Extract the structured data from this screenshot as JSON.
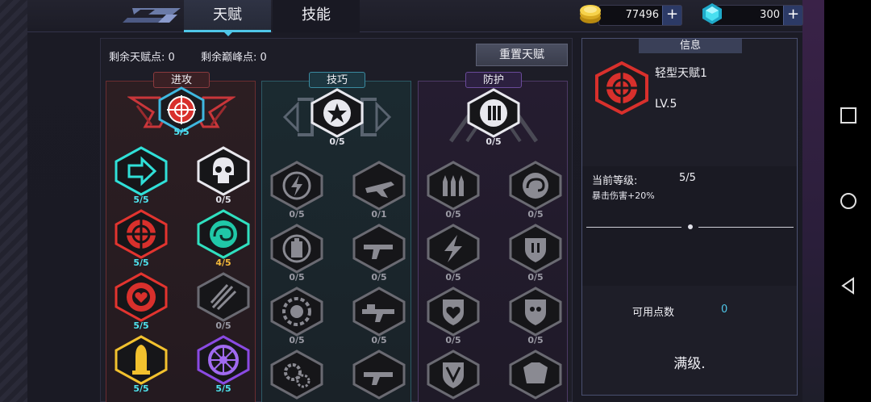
{
  "tabs": {
    "talent": "天赋",
    "skill": "技能"
  },
  "currency": {
    "gold": "77496",
    "gems": "300",
    "plus": "+"
  },
  "points": {
    "talent_label": "剩余天赋点: 0",
    "peak_label": "剩余巅峰点: 0"
  },
  "reset_button": "重置天赋",
  "columns": {
    "attack": {
      "title": "进攻",
      "nodes": [
        {
          "icon": "crosshair-icon",
          "level": "5/5"
        },
        {
          "icon": "arrow-icon",
          "level": "5/5"
        },
        {
          "icon": "skull-icon",
          "level": "0/5"
        },
        {
          "icon": "target-icon",
          "level": "5/5"
        },
        {
          "icon": "swirl-icon",
          "level": "4/5"
        },
        {
          "icon": "heart-gear-icon",
          "level": "5/5"
        },
        {
          "icon": "slash-icon",
          "level": "0/5"
        },
        {
          "icon": "bullet-icon",
          "level": "5/5"
        },
        {
          "icon": "wheel-icon",
          "level": "5/5"
        }
      ]
    },
    "skill": {
      "title": "技巧",
      "nodes": [
        {
          "icon": "star-icon",
          "level": "0/5"
        },
        {
          "icon": "lightning-icon",
          "level": "0/5"
        },
        {
          "icon": "jet-icon",
          "level": "0/1"
        },
        {
          "icon": "battery-icon",
          "level": "0/5"
        },
        {
          "icon": "gun-icon",
          "level": "0/5"
        },
        {
          "icon": "gear-icon",
          "level": "0/5"
        },
        {
          "icon": "rifle-icon",
          "level": "0/5"
        },
        {
          "icon": "gears-icon",
          "level": ""
        },
        {
          "icon": "gun-icon",
          "level": ""
        }
      ]
    },
    "defense": {
      "title": "防护",
      "nodes": [
        {
          "icon": "shield-bullet-icon",
          "level": "0/5"
        },
        {
          "icon": "bullets-icon",
          "level": "0/5"
        },
        {
          "icon": "swirl-icon",
          "level": "0/5"
        },
        {
          "icon": "lightning-icon",
          "level": "0/5"
        },
        {
          "icon": "shield-icon",
          "level": "0/5"
        },
        {
          "icon": "heart-icon",
          "level": "0/5"
        },
        {
          "icon": "skull-shield-icon",
          "level": "0/5"
        },
        {
          "icon": "shield-v-icon",
          "level": ""
        },
        {
          "icon": "armor-icon",
          "level": ""
        }
      ]
    }
  },
  "info": {
    "header": "信息",
    "name": "轻型天赋1",
    "lv": "LV.5",
    "current_label": "当前等级:",
    "current_value": "5/5",
    "effect": "暴击伤害+20%",
    "available_label": "可用点数",
    "available_value": "0",
    "maxed": "满级."
  },
  "colors": {
    "accent_cyan": "#4fe4ef",
    "accent_orange": "#f3b83a",
    "attack_red": "#e2342f",
    "locked_gray": "#8a8a92"
  }
}
